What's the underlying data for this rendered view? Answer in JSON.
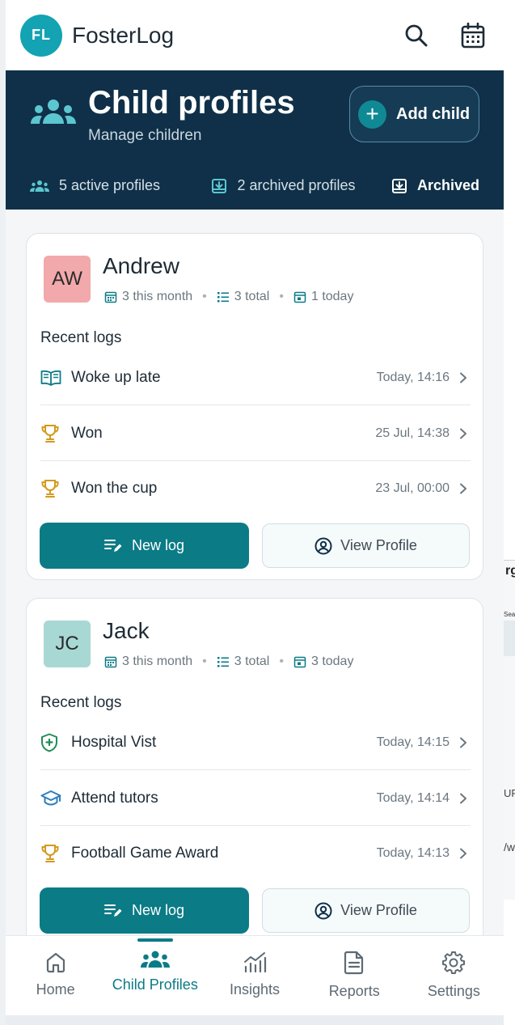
{
  "app": {
    "logo_initials": "FL",
    "name": "FosterLog"
  },
  "header": {
    "title": "Child profiles",
    "subtitle": "Manage children",
    "add_child_label": "Add child",
    "stats": {
      "active": "5 active profiles",
      "archived": "2 archived profiles",
      "archived_link": "Archived"
    }
  },
  "children": [
    {
      "initials": "AW",
      "avatar_color": "#f2a9ab",
      "name": "Andrew",
      "this_month": "3 this month",
      "total": "3 total",
      "today": "1 today",
      "recent_label": "Recent logs",
      "logs": [
        {
          "icon": "book-open-icon",
          "title": "Woke up late",
          "time": "Today, 14:16"
        },
        {
          "icon": "trophy-icon",
          "title": "Won",
          "time": "25 Jul, 14:38"
        },
        {
          "icon": "trophy-icon",
          "title": "Won the cup",
          "time": "23 Jul, 00:00"
        }
      ],
      "new_log_label": "New log",
      "view_profile_label": "View Profile"
    },
    {
      "initials": "JC",
      "avatar_color": "#a8d8d4",
      "name": "Jack",
      "this_month": "3 this month",
      "total": "3 total",
      "today": "3 today",
      "recent_label": "Recent logs",
      "logs": [
        {
          "icon": "medical-shield-icon",
          "title": "Hospital Vist",
          "time": "Today, 14:15"
        },
        {
          "icon": "graduation-cap-icon",
          "title": "Attend tutors",
          "time": "Today, 14:14"
        },
        {
          "icon": "trophy-icon",
          "title": "Football Game Award",
          "time": "Today, 14:13"
        }
      ],
      "new_log_label": "New log",
      "view_profile_label": "View Profile"
    }
  ],
  "nav": [
    {
      "label": "Home",
      "icon": "home-icon"
    },
    {
      "label": "Child Profiles",
      "icon": "people-icon",
      "active": true
    },
    {
      "label": "Insights",
      "icon": "insights-icon"
    },
    {
      "label": "Reports",
      "icon": "document-icon"
    },
    {
      "label": "Settings",
      "icon": "gear-icon"
    }
  ],
  "background_window": {
    "t1": "rg",
    "t2": "Sea",
    "t3": "UR",
    "t4": "/w"
  },
  "colors": {
    "brand": "#0b7b86",
    "header_bg": "#0f3048",
    "logo": "#13a3b3",
    "accent_gold": "#d39a1d"
  }
}
